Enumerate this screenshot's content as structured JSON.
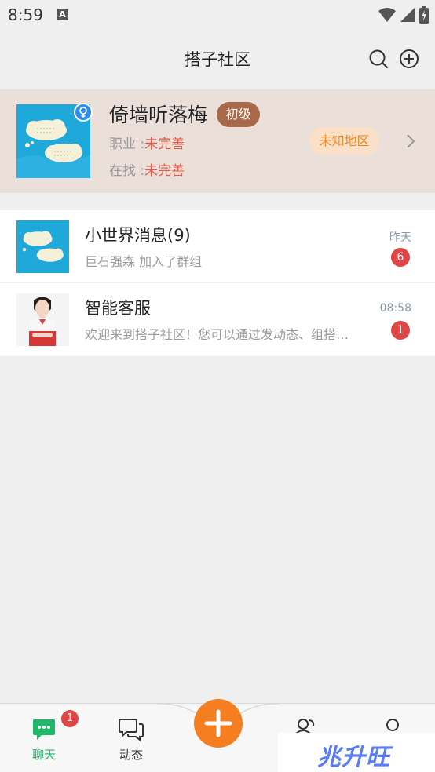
{
  "status_bar": {
    "time": "8:59",
    "notification_icon": "A",
    "icons": [
      "wifi-icon",
      "signal-icon",
      "battery-charging-icon"
    ]
  },
  "header": {
    "title": "搭子社区",
    "icons": [
      "search-icon",
      "add-circle-icon"
    ]
  },
  "profile": {
    "name": "倚墙听落梅",
    "level": "初级",
    "gender_icon": "female-icon",
    "job_label": "职业 :",
    "job_value": "未完善",
    "seeking_label": "在找 :",
    "seeking_value": "未完善",
    "region": "未知地区",
    "arrow_icon": "chevron-right-icon"
  },
  "chats": [
    {
      "name": "小世界消息(9)",
      "preview": "巨石强森 加入了群组",
      "time": "昨天",
      "unread": "6",
      "avatar": "cloud-avatar"
    },
    {
      "name": "智能客服",
      "preview": "欢迎来到搭子社区！您可以通过发动态、组搭子、加入群组认识新朋友…",
      "time": "08:58",
      "unread": "1",
      "avatar": "service-agent-avatar"
    }
  ],
  "tabbar": {
    "tabs": [
      {
        "label": "聊天",
        "icon": "chat-bubble-icon",
        "active": true,
        "badge": "1"
      },
      {
        "label": "动态",
        "icon": "moments-icon",
        "active": false
      },
      {
        "label": "",
        "icon": "add-icon",
        "active": false
      },
      {
        "label": "",
        "icon": "friends-icon",
        "active": false
      },
      {
        "label": "",
        "icon": "profile-icon",
        "active": false
      }
    ]
  },
  "watermark": "兆升旺",
  "colors": {
    "accent_green": "#1fb86a",
    "fab_orange": "#f57e20",
    "badge_red": "#e04646",
    "level_brown": "#a8694a",
    "region_orange": "#f08a26"
  }
}
